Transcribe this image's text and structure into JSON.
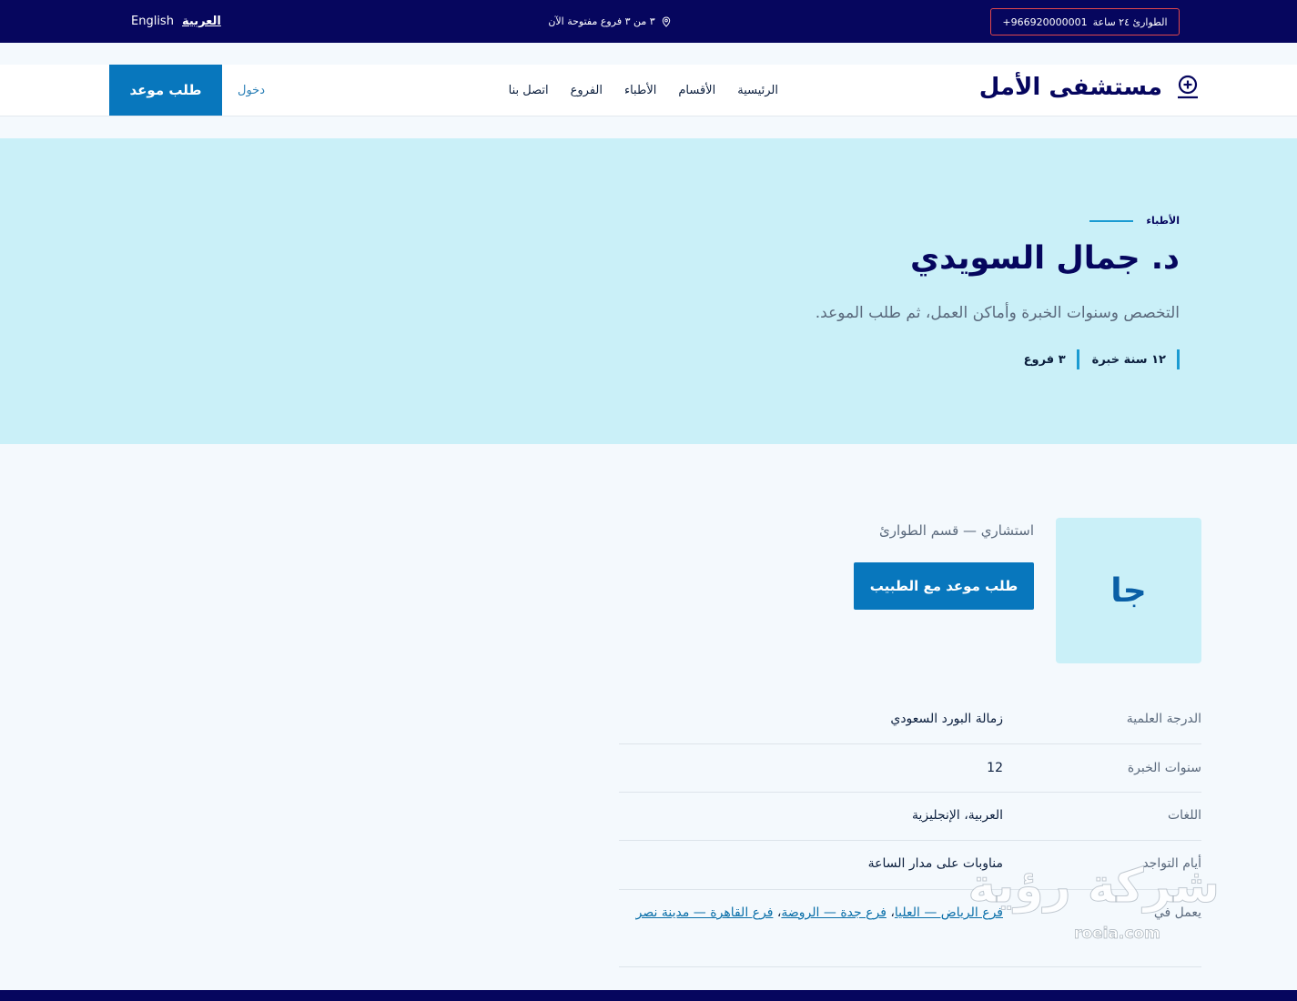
{
  "topbar": {
    "emergency_label": "الطوارئ ٢٤ ساعة",
    "emergency_phone": "+966920000001",
    "branches_open": "٣ من ٣ فروع مفتوحة الآن",
    "lang_ar": "العربية",
    "lang_en": "English"
  },
  "header": {
    "logo_text": "مستشفى الأمل",
    "nav": [
      "الرئيسية",
      "الأقسام",
      "الأطباء",
      "الفروع",
      "اتصل بنا"
    ],
    "login": "دخول",
    "book": "طلب موعد"
  },
  "hero": {
    "eyebrow": "الأطباء",
    "name": "د. جمال السويدي",
    "subtitle": "التخصص وسنوات الخبرة وأماكن العمل، ثم طلب الموعد.",
    "stats": [
      "١٢ سنة خبرة",
      "٣ فروع"
    ]
  },
  "profile": {
    "initials": "جا",
    "role": "استشاري — قسم الطوارئ",
    "book_button": "طلب موعد مع الطبيب"
  },
  "details": {
    "degree_label": "الدرجة العلمية",
    "degree_value": "زمالة البورد السعودي",
    "experience_label": "سنوات الخبرة",
    "experience_value": "12",
    "languages_label": "اللغات",
    "languages_value": "العربية، الإنجليزية",
    "availability_label": "أيام التواجد",
    "availability_value": "مناوبات على مدار الساعة",
    "works_at_label": "يعمل في",
    "branches": [
      "فرع الرياض — العليا",
      "فرع جدة — الروضة",
      "فرع القاهرة — مدينة نصر"
    ]
  },
  "watermark": {
    "main": "شركة رؤية",
    "sub": "roeia.com"
  },
  "colors": {
    "navy": "#06065e",
    "primary": "#0877bd",
    "hero_bg": "#caf0f8",
    "accent": "#1a9bd2"
  }
}
